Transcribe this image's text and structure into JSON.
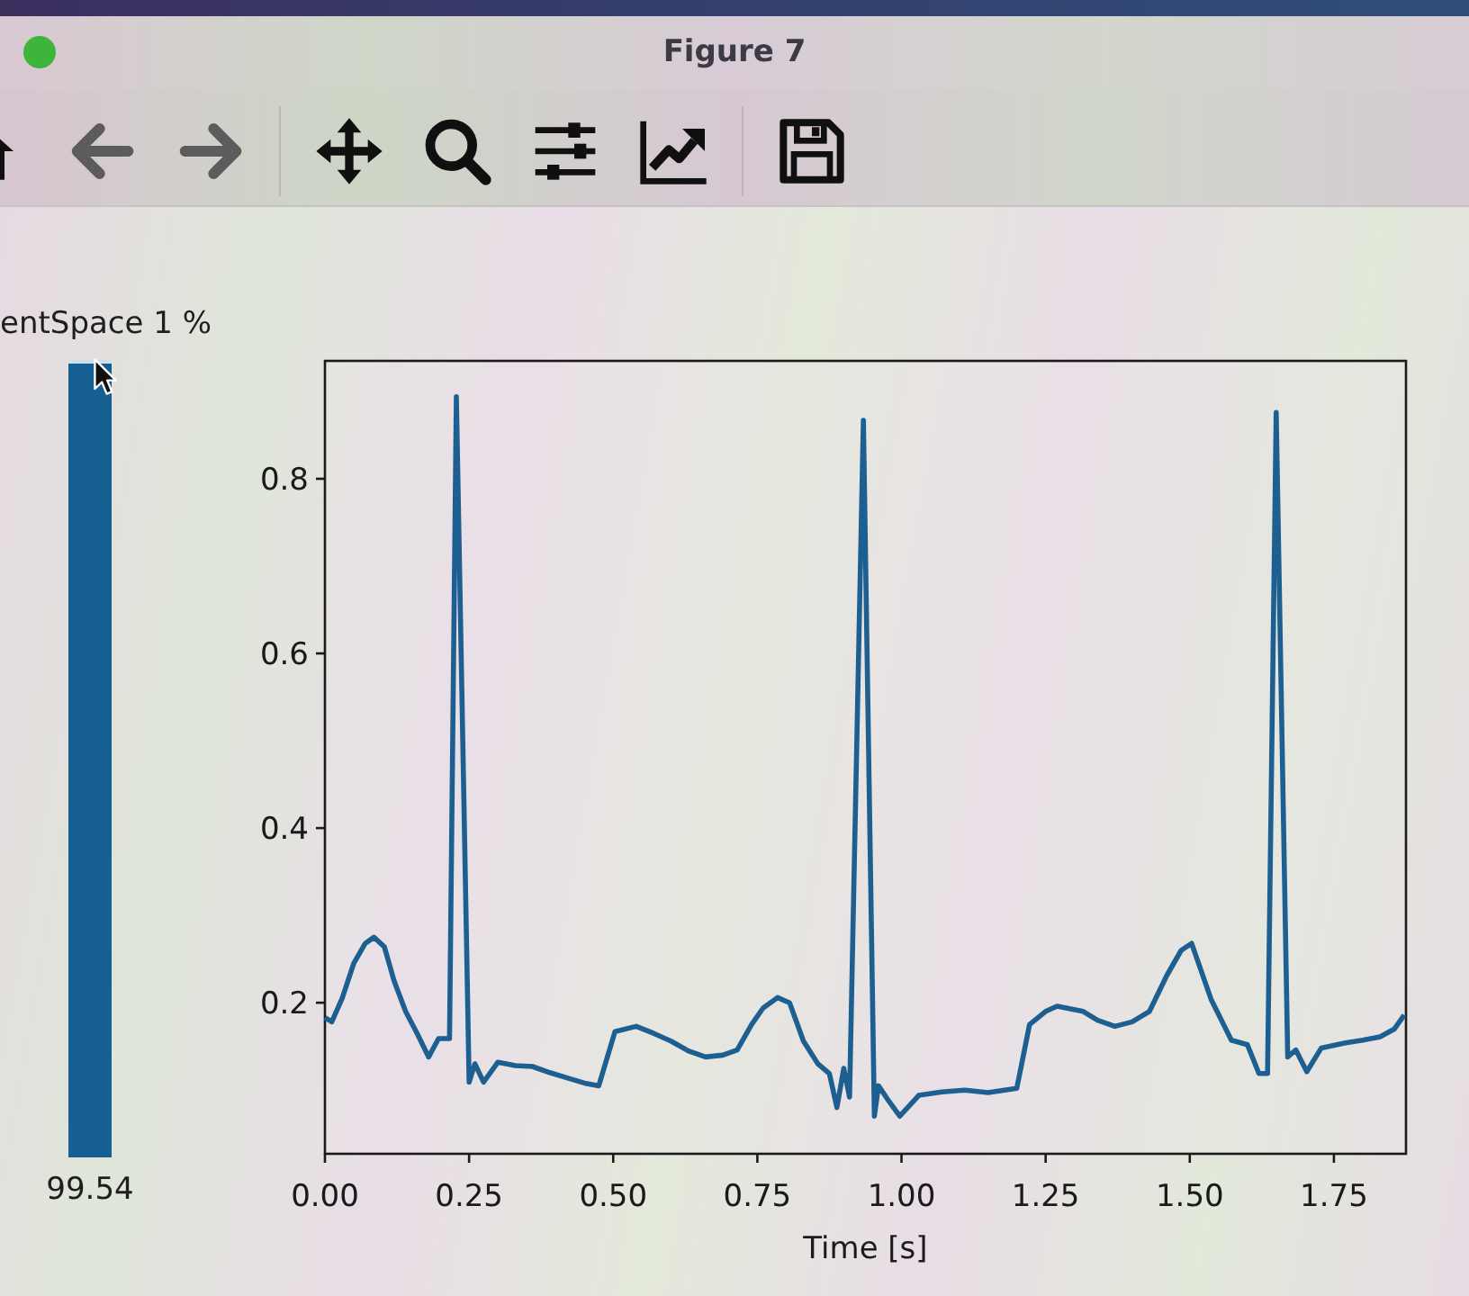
{
  "window": {
    "title": "Figure 7"
  },
  "toolbar": [
    {
      "buttons": [
        {
          "kind": "home",
          "disabled": false
        },
        {
          "kind": "back",
          "disabled": true
        },
        {
          "kind": "forward",
          "disabled": true
        }
      ]
    },
    {
      "buttons": [
        {
          "kind": "pan",
          "disabled": false
        },
        {
          "kind": "zoom",
          "disabled": false
        },
        {
          "kind": "subplots",
          "disabled": false
        },
        {
          "kind": "customize",
          "disabled": false
        }
      ]
    },
    {
      "buttons": [
        {
          "kind": "save",
          "disabled": false
        }
      ]
    }
  ],
  "level_bar": {
    "label": "entSpace 1 %",
    "level": 0.9954,
    "reading": "99.54"
  },
  "plot": {
    "chart_data": {
      "type": "line",
      "xlabel": "Time [s]",
      "x": [
        0,
        0.012,
        0.03,
        0.05,
        0.07,
        0.085,
        0.103,
        0.12,
        0.14,
        0.16,
        0.18,
        0.197,
        0.216,
        0.228,
        0.25,
        0.26,
        0.275,
        0.3,
        0.33,
        0.36,
        0.39,
        0.42,
        0.45,
        0.475,
        0.503,
        0.54,
        0.57,
        0.6,
        0.63,
        0.66,
        0.69,
        0.715,
        0.74,
        0.76,
        0.785,
        0.806,
        0.83,
        0.855,
        0.875,
        0.888,
        0.9,
        0.91,
        0.934,
        0.953,
        0.96,
        0.975,
        0.997,
        1.03,
        1.07,
        1.11,
        1.15,
        1.2,
        1.222,
        1.25,
        1.27,
        1.315,
        1.34,
        1.37,
        1.4,
        1.43,
        1.46,
        1.485,
        1.503,
        1.537,
        1.572,
        1.6,
        1.62,
        1.635,
        1.65,
        1.67,
        1.684,
        1.703,
        1.728,
        1.77,
        1.8,
        1.83,
        1.855,
        1.872
      ],
      "series": [
        {
          "color": "#1c5f90",
          "values": [
            0.183,
            0.178,
            0.205,
            0.245,
            0.268,
            0.275,
            0.264,
            0.225,
            0.19,
            0.165,
            0.138,
            0.159,
            0.159,
            0.894,
            0.109,
            0.13,
            0.109,
            0.132,
            0.128,
            0.127,
            0.12,
            0.114,
            0.108,
            0.105,
            0.167,
            0.173,
            0.165,
            0.156,
            0.145,
            0.138,
            0.14,
            0.146,
            0.175,
            0.194,
            0.206,
            0.2,
            0.156,
            0.13,
            0.119,
            0.08,
            0.125,
            0.092,
            0.867,
            0.07,
            0.105,
            0.09,
            0.07,
            0.094,
            0.098,
            0.1,
            0.097,
            0.102,
            0.175,
            0.19,
            0.196,
            0.19,
            0.18,
            0.173,
            0.178,
            0.19,
            0.231,
            0.26,
            0.268,
            0.204,
            0.157,
            0.152,
            0.119,
            0.119,
            0.876,
            0.138,
            0.146,
            0.121,
            0.148,
            0.154,
            0.157,
            0.161,
            0.17,
            0.186
          ]
        }
      ],
      "xlim": [
        0,
        1.875
      ],
      "ylim": [
        0.027,
        0.935
      ],
      "xticks": [
        {
          "value": 0,
          "label": "0.00"
        },
        {
          "value": 0.25,
          "label": "0.25"
        },
        {
          "value": 0.5,
          "label": "0.50"
        },
        {
          "value": 0.75,
          "label": "0.75"
        },
        {
          "value": 1,
          "label": "1.00"
        },
        {
          "value": 1.25,
          "label": "1.25"
        },
        {
          "value": 1.5,
          "label": "1.50"
        },
        {
          "value": 1.75,
          "label": "1.75"
        }
      ],
      "yticks": [
        0.2,
        0.4,
        0.6,
        0.8
      ]
    }
  }
}
